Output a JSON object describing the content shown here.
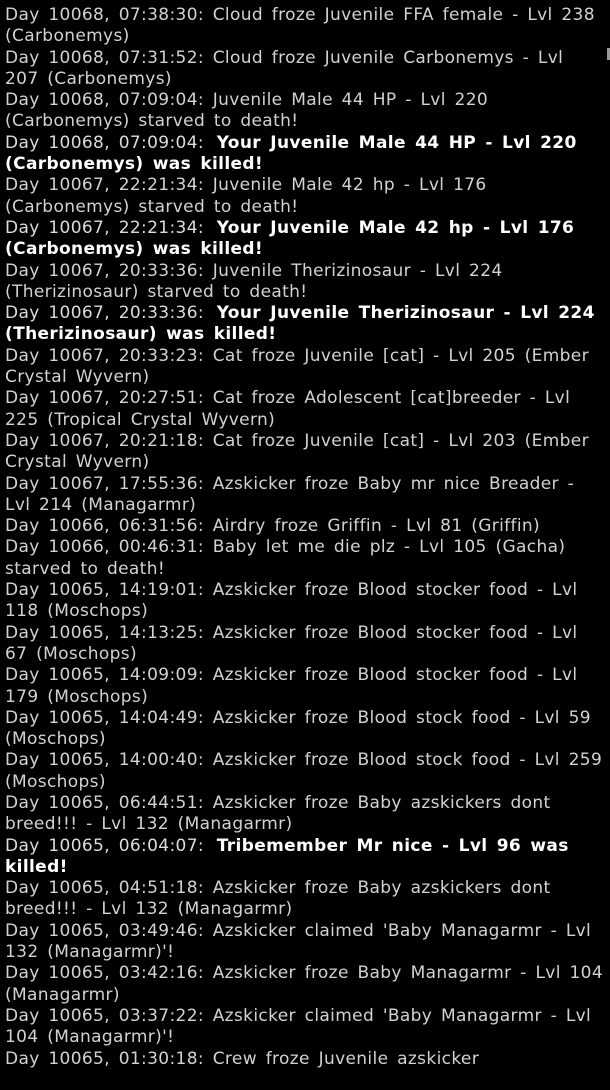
{
  "tribe_log": {
    "entries": [
      {
        "time": "Day 10068, 07:38:30:",
        "text": "Cloud froze Juvenile FFA female - Lvl 238 (Carbonemys)",
        "kind": "normal"
      },
      {
        "time": "Day 10068, 07:31:52:",
        "text": "Cloud froze Juvenile Carbonemys - Lvl 207 (Carbonemys)",
        "kind": "normal"
      },
      {
        "time": "Day 10068, 07:09:04:",
        "text": "Juvenile Male 44 HP - Lvl 220 (Carbonemys) starved to death!",
        "kind": "normal"
      },
      {
        "time": "Day 10068, 07:09:04:",
        "text": "Your Juvenile Male 44 HP - Lvl 220 (Carbonemys) was killed!",
        "kind": "kill"
      },
      {
        "time": "Day 10067, 22:21:34:",
        "text": "Juvenile Male 42 hp - Lvl 176 (Carbonemys) starved to death!",
        "kind": "normal"
      },
      {
        "time": "Day 10067, 22:21:34:",
        "text": "Your Juvenile Male 42 hp - Lvl 176 (Carbonemys) was killed!",
        "kind": "kill"
      },
      {
        "time": "Day 10067, 20:33:36:",
        "text": "Juvenile Therizinosaur - Lvl 224 (Therizinosaur) starved to death!",
        "kind": "normal"
      },
      {
        "time": "Day 10067, 20:33:36:",
        "text": "Your Juvenile Therizinosaur - Lvl 224 (Therizinosaur) was killed!",
        "kind": "kill"
      },
      {
        "time": "Day 10067, 20:33:23:",
        "text": "Cat froze Juvenile [cat] - Lvl 205 (Ember Crystal Wyvern)",
        "kind": "normal"
      },
      {
        "time": "Day 10067, 20:27:51:",
        "text": "Cat froze Adolescent [cat]breeder - Lvl 225 (Tropical Crystal Wyvern)",
        "kind": "normal"
      },
      {
        "time": "Day 10067, 20:21:18:",
        "text": "Cat froze Juvenile [cat] - Lvl 203 (Ember Crystal Wyvern)",
        "kind": "normal"
      },
      {
        "time": "Day 10067, 17:55:36:",
        "text": "Azskicker froze Baby mr nice Breader - Lvl 214 (Managarmr)",
        "kind": "normal"
      },
      {
        "time": "Day 10066, 06:31:56:",
        "text": "Airdry froze Griffin - Lvl 81 (Griffin)",
        "kind": "normal"
      },
      {
        "time": "Day 10066, 00:46:31:",
        "text": "Baby let me die plz - Lvl 105 (Gacha) starved to death!",
        "kind": "normal"
      },
      {
        "time": "Day 10065, 14:19:01:",
        "text": "Azskicker froze Blood stocker food - Lvl 118 (Moschops)",
        "kind": "normal"
      },
      {
        "time": "Day 10065, 14:13:25:",
        "text": "Azskicker froze Blood stocker food - Lvl 67 (Moschops)",
        "kind": "normal"
      },
      {
        "time": "Day 10065, 14:09:09:",
        "text": "Azskicker froze Blood stocker food - Lvl 179 (Moschops)",
        "kind": "normal"
      },
      {
        "time": "Day 10065, 14:04:49:",
        "text": "Azskicker froze Blood stock food - Lvl 59 (Moschops)",
        "kind": "normal"
      },
      {
        "time": "Day 10065, 14:00:40:",
        "text": "Azskicker froze Blood stock food - Lvl 259 (Moschops)",
        "kind": "normal"
      },
      {
        "time": "Day 10065, 06:44:51:",
        "text": "Azskicker froze Baby azskickers dont breed!!! - Lvl 132 (Managarmr)",
        "kind": "normal"
      },
      {
        "time": "Day 10065, 06:04:07:",
        "text": "Tribemember Mr nice - Lvl 96 was killed!",
        "kind": "kill"
      },
      {
        "time": "Day 10065, 04:51:18:",
        "text": "Azskicker froze Baby azskickers dont breed!!! - Lvl 132 (Managarmr)",
        "kind": "normal"
      },
      {
        "time": "Day 10065, 03:49:46:",
        "text": "Azskicker claimed 'Baby Managarmr - Lvl 132 (Managarmr)'!",
        "kind": "normal"
      },
      {
        "time": "Day 10065, 03:42:16:",
        "text": "Azskicker froze Baby Managarmr - Lvl 104 (Managarmr)",
        "kind": "normal"
      },
      {
        "time": "Day 10065, 03:37:22:",
        "text": "Azskicker claimed 'Baby Managarmr - Lvl 104 (Managarmr)'!",
        "kind": "normal"
      },
      {
        "time": "Day 10065, 01:30:18:",
        "text": "Crew froze Juvenile azskicker",
        "kind": "normal"
      }
    ]
  }
}
